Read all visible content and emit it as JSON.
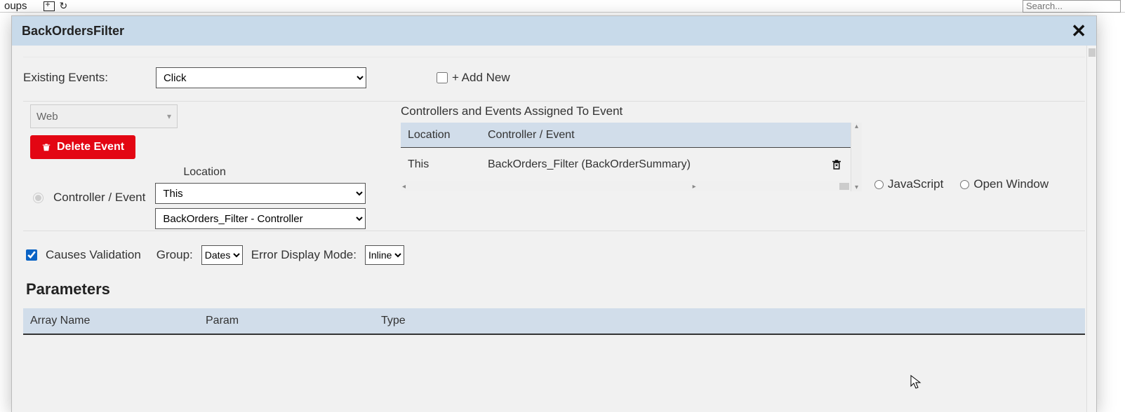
{
  "bg": {
    "left_fragment": "oups",
    "search_placeholder": "Search..."
  },
  "dialog": {
    "title": "BackOrdersFilter"
  },
  "existing": {
    "label": "Existing Events:",
    "selected": "Click",
    "add_new_label": "+ Add New"
  },
  "platform": {
    "selected": "Web"
  },
  "delete_btn": "Delete Event",
  "controller_event": {
    "radio_label": "Controller / Event",
    "location_label": "Location",
    "location_selected": "This",
    "controller_selected": "BackOrders_Filter - Controller"
  },
  "assigned": {
    "title": "Controllers and Events Assigned To Event",
    "head_location": "Location",
    "head_controller": "Controller / Event",
    "rows": [
      {
        "location": "This",
        "controller": "BackOrders_Filter (BackOrderSummary)"
      }
    ]
  },
  "right_radios": {
    "js": "JavaScript",
    "open_window": "Open Window"
  },
  "opts": {
    "causes_validation": "Causes Validation",
    "group_label": "Group:",
    "group_selected": "Dates",
    "error_mode_label": "Error Display Mode:",
    "error_mode_selected": "Inline"
  },
  "params": {
    "title": "Parameters",
    "head_array": "Array Name",
    "head_param": "Param",
    "head_type": "Type"
  }
}
